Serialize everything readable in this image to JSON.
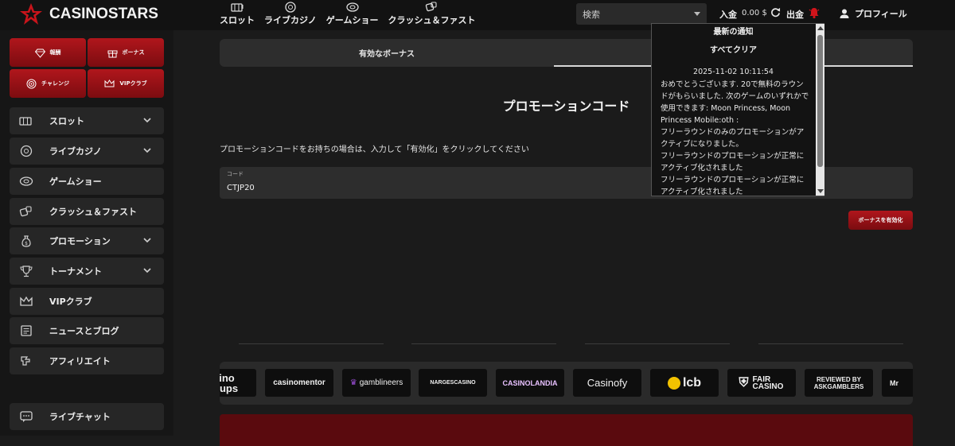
{
  "brand": {
    "name": "CASINOSTARS",
    "accent": "#c8141b"
  },
  "topnav": [
    {
      "label": "スロット",
      "icon": "slot-machine-icon"
    },
    {
      "label": "ライブカジノ",
      "icon": "poker-chip-icon"
    },
    {
      "label": "ゲームショー",
      "icon": "wheel-icon"
    },
    {
      "label": "クラッシュ＆ファスト",
      "icon": "dice-icon"
    }
  ],
  "header": {
    "search_placeholder": "検索",
    "deposit_label": "入金",
    "balance": "0.00 $",
    "withdraw_label": "出金",
    "profile_label": "プロフィール"
  },
  "sidebar": {
    "promo_buttons": [
      {
        "label": "報酬",
        "icon": "diamond-icon"
      },
      {
        "label": "ボーナス",
        "icon": "gift-icon"
      },
      {
        "label": "チャレンジ",
        "icon": "target-icon"
      },
      {
        "label": "VIPクラブ",
        "icon": "crown-icon"
      }
    ],
    "items": [
      {
        "label": "スロット",
        "icon": "slot-machine-icon",
        "expandable": true
      },
      {
        "label": "ライブカジノ",
        "icon": "poker-chip-icon",
        "expandable": true
      },
      {
        "label": "ゲームショー",
        "icon": "wheel-icon",
        "expandable": false
      },
      {
        "label": "クラッシュ＆ファスト",
        "icon": "dice-icon",
        "expandable": false
      },
      {
        "label": "プロモーション",
        "icon": "money-bag-icon",
        "expandable": true
      },
      {
        "label": "トーナメント",
        "icon": "trophy-icon",
        "expandable": true
      },
      {
        "label": "VIPクラブ",
        "icon": "crown-icon",
        "expandable": false
      },
      {
        "label": "ニュースとブログ",
        "icon": "newspaper-icon",
        "expandable": false
      },
      {
        "label": "アフィリエイト",
        "icon": "handshake-icon",
        "expandable": false
      }
    ],
    "live_chat": {
      "label": "ライブチャット",
      "icon": "chat-icon"
    }
  },
  "main": {
    "tab_active": "有効なボーナス",
    "title": "プロモーションコード",
    "instruction": "プロモーションコードをお持ちの場合は、入力して「有効化」をクリックしてください",
    "code_label": "コード",
    "code_value": "CTJP20",
    "activate_label": "ボーナスを有効化"
  },
  "partners": [
    "sino oups",
    "casinomentor",
    "gamblineers",
    "NARGESCASINO",
    "CASINOLANDIA",
    "Casinofy",
    "lcb",
    "FAIR CASINO",
    "REVIEWED BY ASKGAMBLERS",
    "Mr"
  ],
  "notification": {
    "heading": "最新の通知",
    "clear_all": "すべてクリア",
    "timestamp": "2025-11-02 10:11:54",
    "message": "おめでとうございます. 20で無料のラウンドがもらいました. 次のゲームのいずれかで使用できます: Moon Princess, Moon Princess Mobile:oth :\nフリーラウンドのみのプロモーションがアクティブになりました。\nフリーラウンドのプロモーションが正常にアクティブ化されました\nフリーラウンドのプロモーションが正常にアクティブ化されました"
  }
}
